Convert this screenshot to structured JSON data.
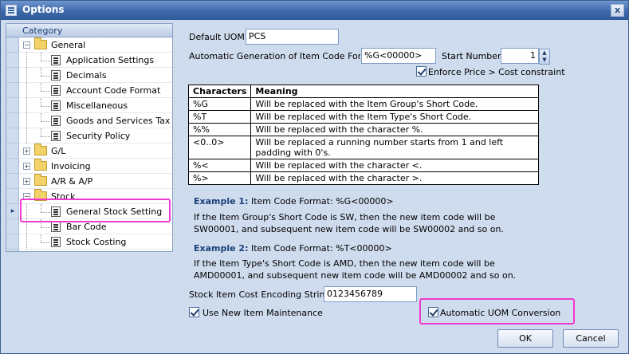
{
  "window": {
    "title": "Options",
    "close_label": "x"
  },
  "tree": {
    "header": "Category",
    "items": [
      {
        "label": "General",
        "type": "folder",
        "level": 0,
        "expanded": true
      },
      {
        "label": "Application Settings",
        "type": "doc",
        "level": 1
      },
      {
        "label": "Decimals",
        "type": "doc",
        "level": 1
      },
      {
        "label": "Account Code Format",
        "type": "doc",
        "level": 1
      },
      {
        "label": "Miscellaneous",
        "type": "doc",
        "level": 1
      },
      {
        "label": "Goods and Services Tax",
        "type": "doc",
        "level": 1
      },
      {
        "label": "Security Policy",
        "type": "doc",
        "level": 1
      },
      {
        "label": "G/L",
        "type": "folder",
        "level": 0,
        "expanded": false
      },
      {
        "label": "Invoicing",
        "type": "folder",
        "level": 0,
        "expanded": false
      },
      {
        "label": "A/R & A/P",
        "type": "folder",
        "level": 0,
        "expanded": false
      },
      {
        "label": "Stock",
        "type": "folder",
        "level": 0,
        "expanded": true
      },
      {
        "label": "General Stock Setting",
        "type": "doc",
        "level": 1,
        "selected": true
      },
      {
        "label": "Bar Code",
        "type": "doc",
        "level": 1
      },
      {
        "label": "Stock Costing",
        "type": "doc",
        "level": 1
      }
    ]
  },
  "form": {
    "default_uom_label": "Default UOM:",
    "default_uom_value": "PCS",
    "autogen_label": "Automatic Generation of Item Code Format:",
    "autogen_value": "%G<00000>",
    "start_number_label": "Start Number:",
    "start_number_value": "1",
    "enforce_label": "Enforce Price > Cost constraint",
    "table_headers": [
      "Characters",
      "Meaning"
    ],
    "table_rows": [
      [
        "%G",
        "Will be replaced with the Item Group's Short Code."
      ],
      [
        "%T",
        "Will be replaced with the Item Type's Short Code."
      ],
      [
        "%%",
        "Will be replaced with the character %."
      ],
      [
        "<0..0>",
        "Will be replaced a running number starts from 1 and left padding with 0's."
      ],
      [
        "%<",
        "Will be replaced with the character <."
      ],
      [
        "%>",
        "Will be replaced with the character >."
      ]
    ],
    "example1_title": "Example 1:",
    "example1_format": " Item Code Format: %G<00000>",
    "example1_line1": "If the Item Group's Short Code is SW, then the new item code will be",
    "example1_line2": "SW00001, and subsequent new item code will be SW00002 and so on.",
    "example2_title": "Example 2:",
    "example2_format": " Item Code Format: %T<00000>",
    "example2_line1": "If the Item Type's Short Code is AMD, then the new item code will be",
    "example2_line2": "AMD00001, and subsequent new item code will be AMD00002 and so on.",
    "cost_encoding_label": "Stock Item Cost Encoding String:",
    "cost_encoding_value": "0123456789",
    "use_new_item_label": "Use New Item Maintenance",
    "auto_uom_label": "Automatic UOM Conversion"
  },
  "buttons": {
    "ok": "OK",
    "cancel": "Cancel"
  }
}
